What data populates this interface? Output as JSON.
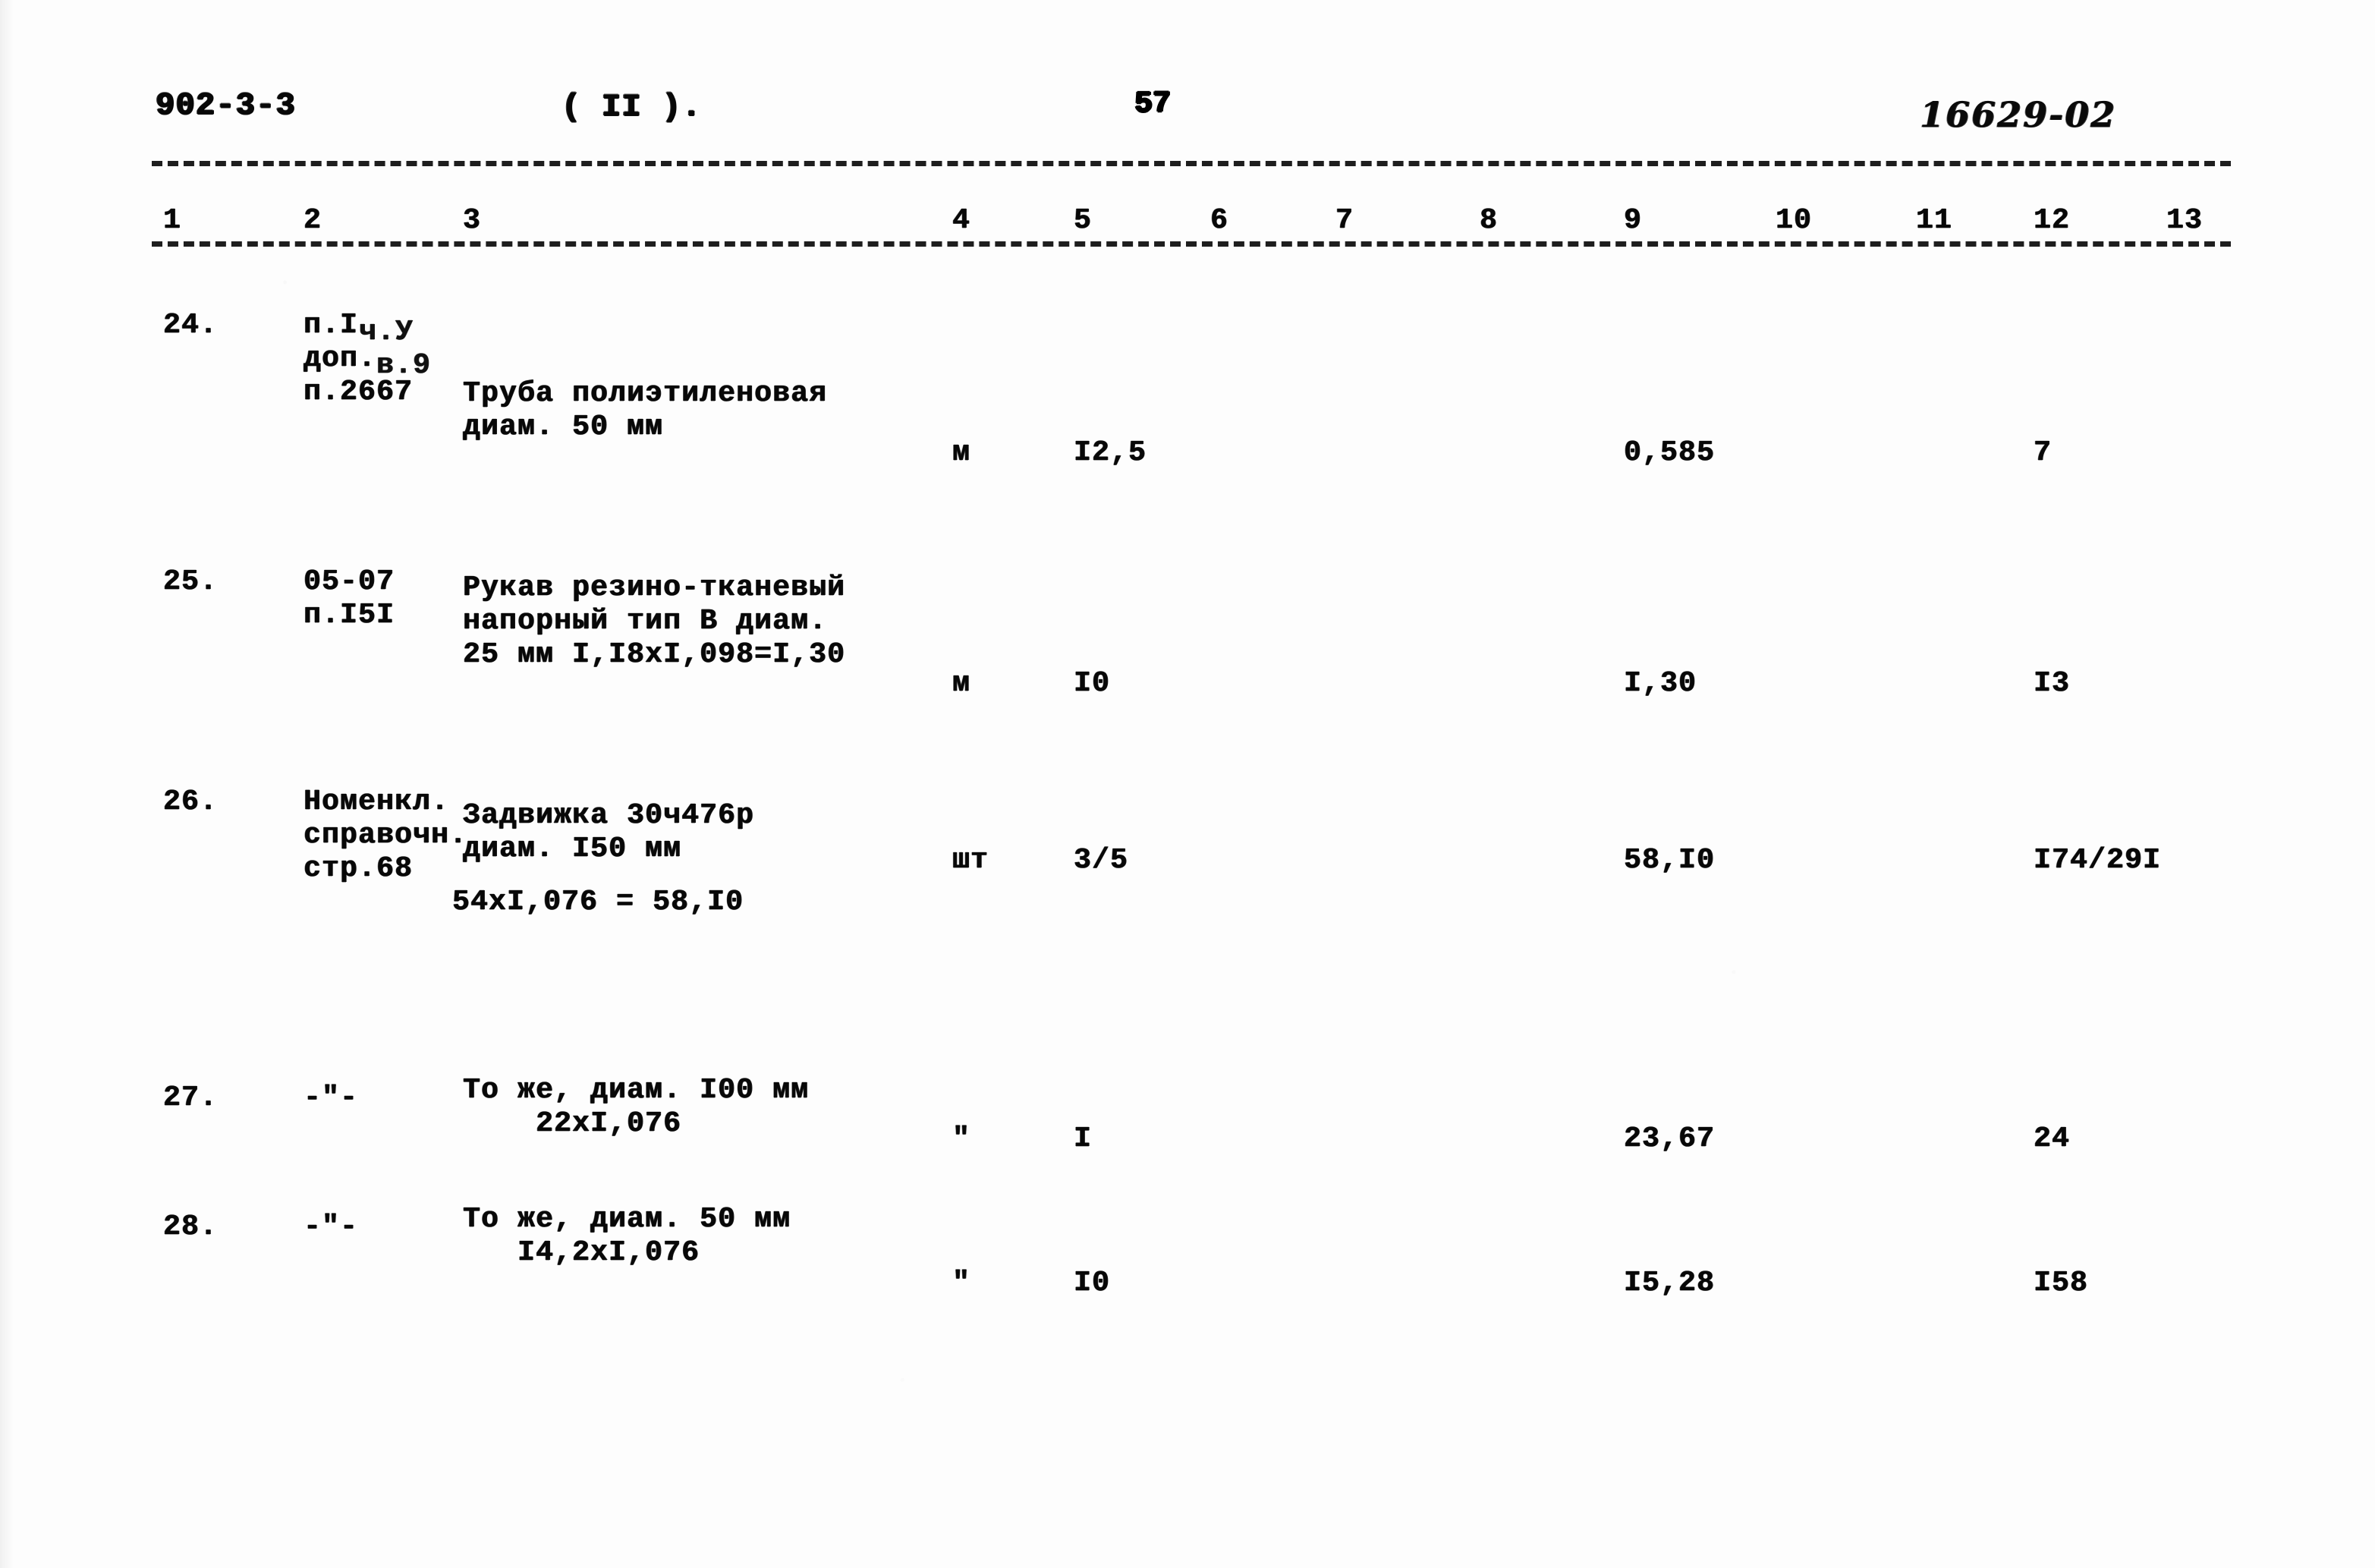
{
  "header": {
    "doc_code": "902-3-3",
    "section_mark": "( II ).",
    "page_number": "57",
    "archive_code_handwritten": "16629-02"
  },
  "column_numbers": [
    "1",
    "2",
    "3",
    "4",
    "5",
    "6",
    "7",
    "8",
    "9",
    "10",
    "11",
    "12",
    "13"
  ],
  "rows": [
    {
      "no": "24.",
      "ref_lines": [
        "п.I",
        "доп.",
        "п.2667"
      ],
      "ref_overstrike": [
        "ч.У",
        "в.9",
        ""
      ],
      "desc_lines": [
        "Труба полиэтиленовая",
        "диам. 50 мм"
      ],
      "calc_line": "",
      "unit": "м",
      "qty": "I2,5",
      "c6": "",
      "c7": "",
      "c8": "",
      "price": "0,585",
      "c10": "",
      "c11": "",
      "total": "7",
      "c13": ""
    },
    {
      "no": "25.",
      "ref_lines": [
        "05-07",
        "п.I5I"
      ],
      "ref_overstrike": [
        "",
        ""
      ],
      "desc_lines": [
        "Рукав резино-тканевый",
        "напорный тип В диам.",
        "25 мм I,I8xI,098=I,30"
      ],
      "calc_line": "",
      "unit": "м",
      "qty": "I0",
      "c6": "",
      "c7": "",
      "c8": "",
      "price": "I,30",
      "c10": "",
      "c11": "",
      "total": "I3",
      "c13": ""
    },
    {
      "no": "26.",
      "ref_lines": [
        "Номенкл.",
        "справочн.",
        "стр.68"
      ],
      "ref_overstrike": [
        "",
        "",
        ""
      ],
      "desc_lines": [
        "Задвижка 30ч476р",
        "диам. I50 мм"
      ],
      "calc_line": "54xI,076 = 58,I0",
      "unit": "шт",
      "qty": "3/5",
      "c6": "",
      "c7": "",
      "c8": "",
      "price": "58,I0",
      "c10": "",
      "c11": "",
      "total": "I74/29I",
      "c13": ""
    },
    {
      "no": "27.",
      "ref_lines": [
        "-\"-"
      ],
      "ref_overstrike": [
        ""
      ],
      "desc_lines": [
        "То же, диам. I00 мм",
        "    22xI,076"
      ],
      "calc_line": "",
      "unit": "\"",
      "qty": "I",
      "c6": "",
      "c7": "",
      "c8": "",
      "price": "23,67",
      "c10": "",
      "c11": "",
      "total": "24",
      "c13": ""
    },
    {
      "no": "28.",
      "ref_lines": [
        "-\"-"
      ],
      "ref_overstrike": [
        ""
      ],
      "desc_lines": [
        "То же, диам. 50 мм",
        "   I4,2xI,076"
      ],
      "calc_line": "",
      "unit": "\"",
      "qty": "I0",
      "c6": "",
      "c7": "",
      "c8": "",
      "price": "I5,28",
      "c10": "",
      "c11": "",
      "total": "I58",
      "c13": ""
    }
  ]
}
